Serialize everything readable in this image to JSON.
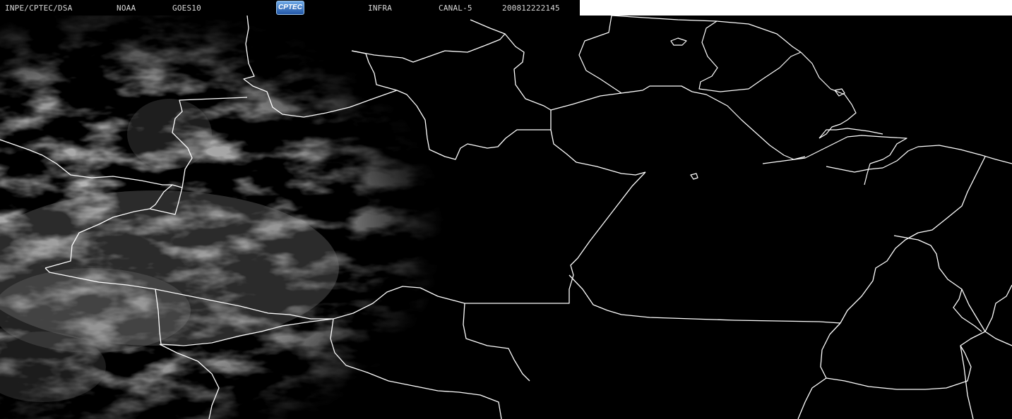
{
  "header": {
    "institution": "INPE/CPTEC/DSA",
    "agency": "NOAA",
    "satellite": "GOES10",
    "logo_text": "CPTEC",
    "product": "INFRA",
    "channel": "CANAL-5",
    "timestamp": "200812222145"
  },
  "colors": {
    "background": "#000000",
    "borders": "#ffffff",
    "clouds": "#9a9a9a",
    "header_text": "#d8d8d8"
  }
}
